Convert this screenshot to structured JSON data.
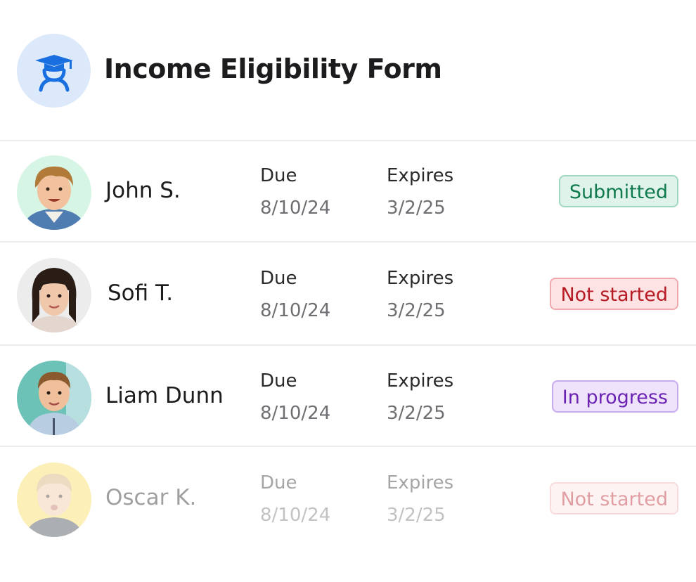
{
  "header": {
    "title": "Income Eligibility Form",
    "icon": "graduation-cap-student-icon",
    "icon_color": "#1a6fe0"
  },
  "columns": {
    "due_label": "Due",
    "expires_label": "Expires"
  },
  "students": [
    {
      "name": "John S.",
      "due": "8/10/24",
      "expires": "3/2/25",
      "status": "Submitted",
      "status_key": "submitted",
      "status_color": "#0f7a4d",
      "faded": false
    },
    {
      "name": "Sofi T.",
      "due": "8/10/24",
      "expires": "3/2/25",
      "status": "Not started",
      "status_key": "not-started",
      "status_color": "#b61b24",
      "faded": false
    },
    {
      "name": "Liam Dunn",
      "due": "8/10/24",
      "expires": "3/2/25",
      "status": "In progress",
      "status_key": "in-progress",
      "status_color": "#6c23b4",
      "faded": false
    },
    {
      "name": "Oscar K.",
      "due": "8/10/24",
      "expires": "3/2/25",
      "status": "Not started",
      "status_key": "not-started",
      "status_color": "#b61b24",
      "faded": true
    }
  ]
}
